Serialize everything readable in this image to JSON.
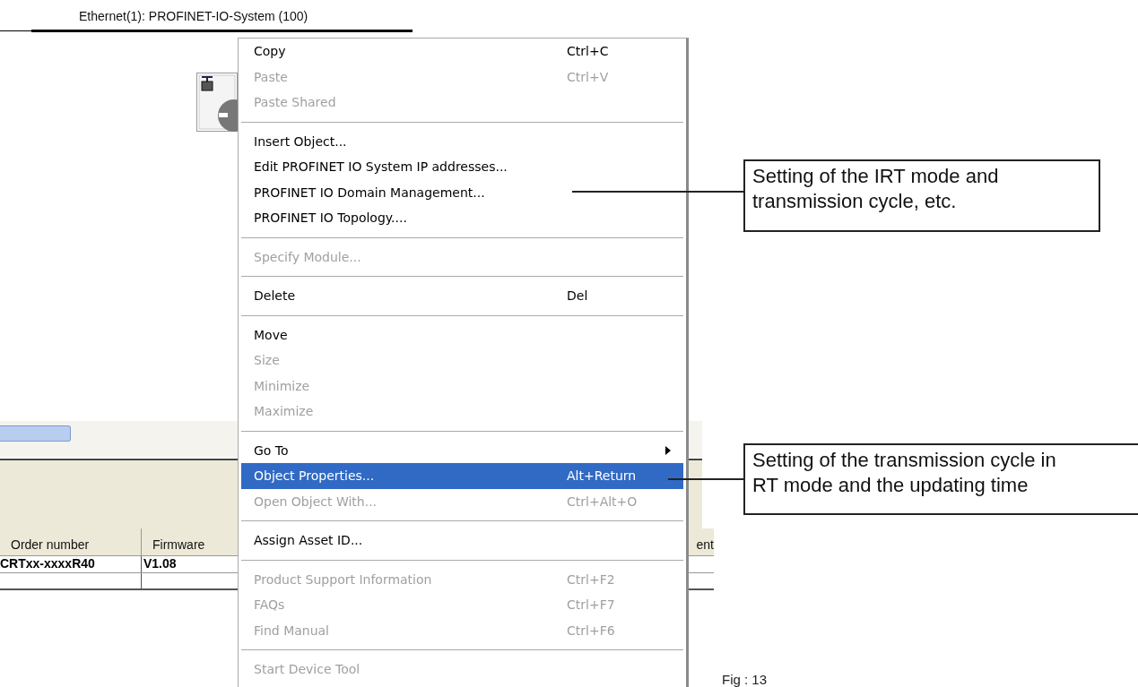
{
  "network": {
    "title": "Ethernet(1): PROFINET-IO-System (100)"
  },
  "table": {
    "columns": [
      "Order number",
      "Firmware",
      "ent"
    ],
    "rows": [
      [
        "CRTxx-xxxxR40",
        "V1.08"
      ]
    ]
  },
  "menu": {
    "items": [
      {
        "kind": "item",
        "label": "Copy",
        "shortcut": "Ctrl+C",
        "disabled": false,
        "selected": false,
        "submenu": false
      },
      {
        "kind": "item",
        "label": "Paste",
        "shortcut": "Ctrl+V",
        "disabled": true,
        "selected": false,
        "submenu": false
      },
      {
        "kind": "item",
        "label": "Paste Shared",
        "disabled": true,
        "selected": false,
        "submenu": false
      },
      {
        "kind": "separator"
      },
      {
        "kind": "item",
        "label": "Insert Object...",
        "disabled": false,
        "selected": false,
        "submenu": false
      },
      {
        "kind": "item",
        "label": "Edit PROFINET IO System IP addresses...",
        "disabled": false,
        "selected": false,
        "submenu": false
      },
      {
        "kind": "item",
        "label": "PROFINET IO Domain Management...",
        "disabled": false,
        "selected": false,
        "submenu": false
      },
      {
        "kind": "item",
        "label": "PROFINET IO Topology....",
        "disabled": false,
        "selected": false,
        "submenu": false
      },
      {
        "kind": "separator"
      },
      {
        "kind": "item",
        "label": "Specify Module...",
        "disabled": true,
        "selected": false,
        "submenu": false
      },
      {
        "kind": "separator"
      },
      {
        "kind": "item",
        "label": "Delete",
        "shortcut": "Del",
        "disabled": false,
        "selected": false,
        "submenu": false
      },
      {
        "kind": "separator"
      },
      {
        "kind": "item",
        "label": "Move",
        "disabled": false,
        "selected": false,
        "submenu": false
      },
      {
        "kind": "item",
        "label": "Size",
        "disabled": true,
        "selected": false,
        "submenu": false
      },
      {
        "kind": "item",
        "label": "Minimize",
        "disabled": true,
        "selected": false,
        "submenu": false
      },
      {
        "kind": "item",
        "label": "Maximize",
        "disabled": true,
        "selected": false,
        "submenu": false
      },
      {
        "kind": "separator"
      },
      {
        "kind": "item",
        "label": "Go To",
        "disabled": false,
        "selected": false,
        "submenu": true
      },
      {
        "kind": "item",
        "label": "Object Properties...",
        "shortcut": "Alt+Return",
        "disabled": false,
        "selected": true,
        "submenu": false
      },
      {
        "kind": "item",
        "label": "Open Object With...",
        "shortcut": "Ctrl+Alt+O",
        "disabled": true,
        "selected": false,
        "submenu": false
      },
      {
        "kind": "separator"
      },
      {
        "kind": "item",
        "label": "Assign Asset ID...",
        "disabled": false,
        "selected": false,
        "submenu": false
      },
      {
        "kind": "separator"
      },
      {
        "kind": "item",
        "label": "Product Support Information",
        "shortcut": "Ctrl+F2",
        "disabled": true,
        "selected": false,
        "submenu": false
      },
      {
        "kind": "item",
        "label": "FAQs",
        "shortcut": "Ctrl+F7",
        "disabled": true,
        "selected": false,
        "submenu": false
      },
      {
        "kind": "item",
        "label": "Find Manual",
        "shortcut": "Ctrl+F6",
        "disabled": true,
        "selected": false,
        "submenu": false
      },
      {
        "kind": "separator"
      },
      {
        "kind": "item",
        "label": "Start Device Tool",
        "disabled": true,
        "selected": false,
        "submenu": false
      }
    ]
  },
  "callouts": [
    {
      "text": "Setting of the IRT mode and transmission cycle, etc."
    },
    {
      "text": "Setting of the transmission cycle in RT mode and the updating time"
    }
  ],
  "caption": "Fig : 13"
}
